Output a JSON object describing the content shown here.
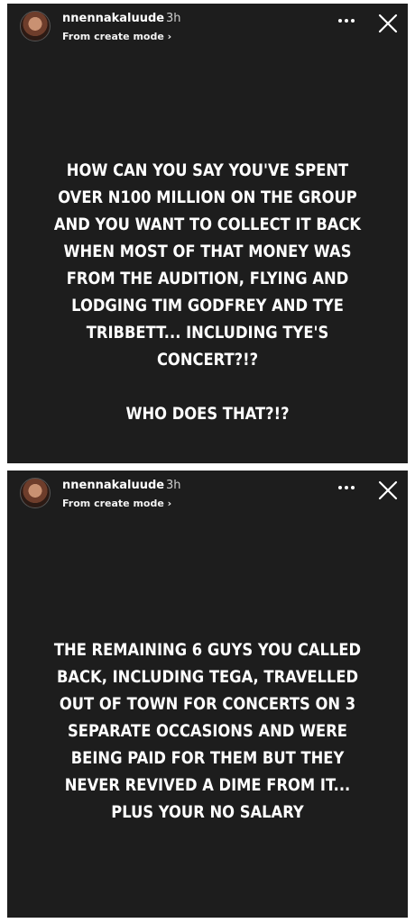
{
  "stories": [
    {
      "username": "nnennakaluude",
      "time": "3h",
      "mode_link": "From create mode ›",
      "more_icon": "more-horizontal-icon",
      "close_icon": "close-icon",
      "text": "HOW CAN YOU SAY YOU'VE SPENT\nOVER N100 MILLION ON THE GROUP\nAND YOU WANT TO COLLECT IT BACK\nWHEN MOST OF THAT MONEY WAS\nFROM THE AUDITION, FLYING AND\nLODGING TIM GODFREY AND TYE\nTRIBBETT... INCLUDING TYE'S\nCONCERT?!?\n\nWHO DOES THAT?!?"
    },
    {
      "username": "nnennakaluude",
      "time": "3h",
      "mode_link": "From create mode ›",
      "more_icon": "more-horizontal-icon",
      "close_icon": "close-icon",
      "text": "THE REMAINING 6 GUYS YOU CALLED\nBACK, INCLUDING TEGA, TRAVELLED\nOUT OF TOWN FOR CONCERTS ON 3\nSEPARATE OCCASIONS AND WERE\nBEING PAID FOR THEM BUT THEY\nNEVER REVIVED A DIME FROM IT...\nPLUS YOUR NO SALARY"
    }
  ]
}
